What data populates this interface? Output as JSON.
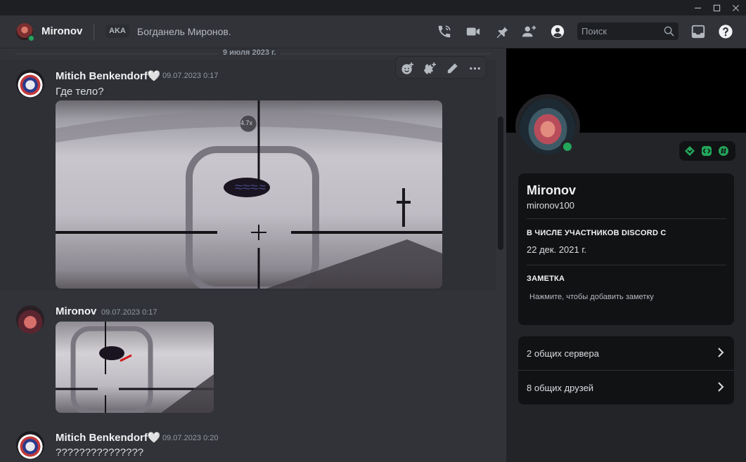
{
  "window": {
    "minimize_icon": "minimize-icon",
    "maximize_icon": "maximize-icon",
    "close_icon": "close-icon"
  },
  "header": {
    "name": "Mironov",
    "aka_label": "AKA",
    "nickname": "Богданель Миронов.",
    "search_placeholder": "Поиск",
    "icons": [
      "voice-call-icon",
      "video-call-icon",
      "pin-icon",
      "add-friend-icon",
      "user-profile-icon",
      "inbox-icon",
      "help-icon"
    ],
    "status_color": "#23a55a"
  },
  "chat": {
    "date_divider": "9 июля 2023 г.",
    "messages": [
      {
        "author": "Mitich Benkendorf🤍",
        "timestamp": "09.07.2023 0:17",
        "text": "Где тело?",
        "attachment": "image"
      },
      {
        "author": "Mironov",
        "timestamp": "09.07.2023 0:17",
        "text": "",
        "attachment": "image"
      },
      {
        "author": "Mitich Benkendorf🤍",
        "timestamp": "09.07.2023 0:20",
        "text": "???????????????"
      }
    ],
    "image_zoom_label": "4.7x",
    "toolbar": [
      "add-reaction-icon",
      "super-reaction-icon",
      "edit-icon",
      "more-icon"
    ]
  },
  "profile": {
    "display_name": "Mironov",
    "username": "mironov100",
    "member_since_heading": "В ЧИСЛЕ УЧАСТНИКОВ DISCORD С",
    "member_since": "22 дек. 2021 г.",
    "note_heading": "ЗАМЕТКА",
    "note_placeholder": "Нажмите, чтобы добавить заметку",
    "mutual_servers": "2 общих сервера",
    "mutual_friends": "8 общих друзей",
    "badges": [
      "hypesquad-icon",
      "active-developer-icon",
      "server-tag-icon"
    ],
    "badge_color": "#23a55a"
  }
}
